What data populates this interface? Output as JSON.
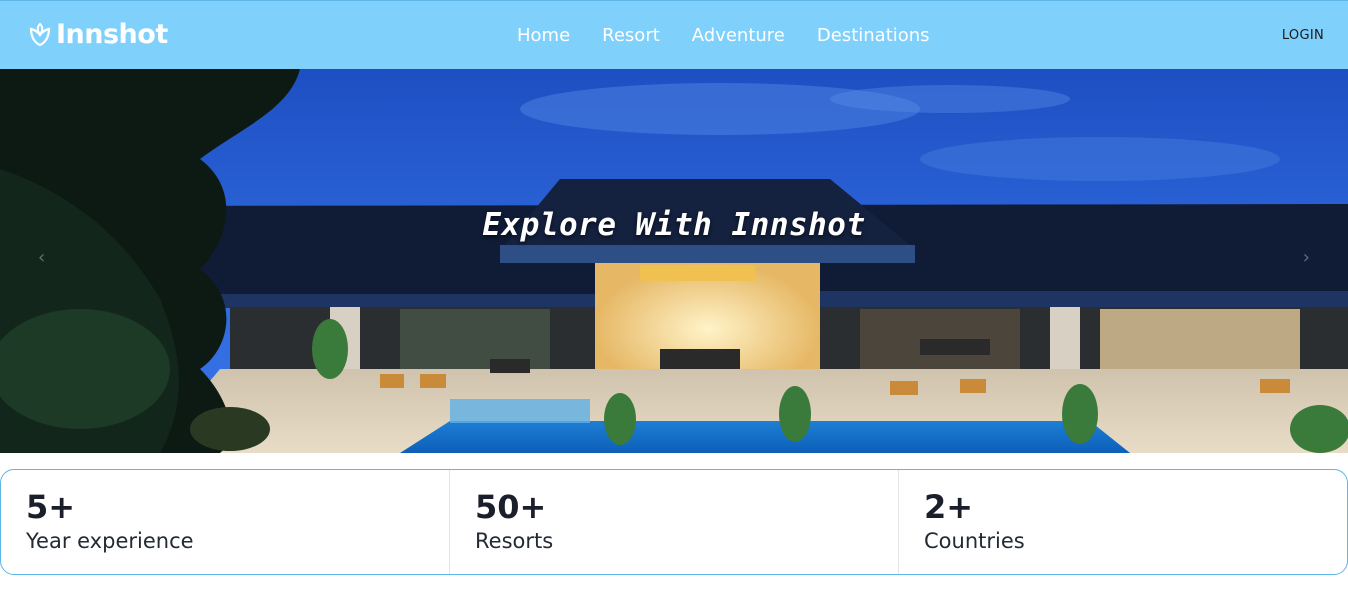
{
  "brand": {
    "name": "Innshot",
    "icon": "flower-logo-icon"
  },
  "nav": {
    "links": [
      "Home",
      "Resort",
      "Adventure",
      "Destinations"
    ],
    "login": "LOGIN"
  },
  "hero": {
    "title": "Explore With Innshot",
    "prev_icon": "chevron-left-icon",
    "next_icon": "chevron-right-icon",
    "prev_glyph": "‹",
    "next_glyph": "›"
  },
  "stats": [
    {
      "value": "5+",
      "label": "Year experience"
    },
    {
      "value": "50+",
      "label": "Resorts"
    },
    {
      "value": "2+",
      "label": "Countries"
    }
  ],
  "colors": {
    "navbar": "#7fd1fc",
    "accent_border": "#5fb6e6",
    "text_dark": "#1a1f2b"
  }
}
